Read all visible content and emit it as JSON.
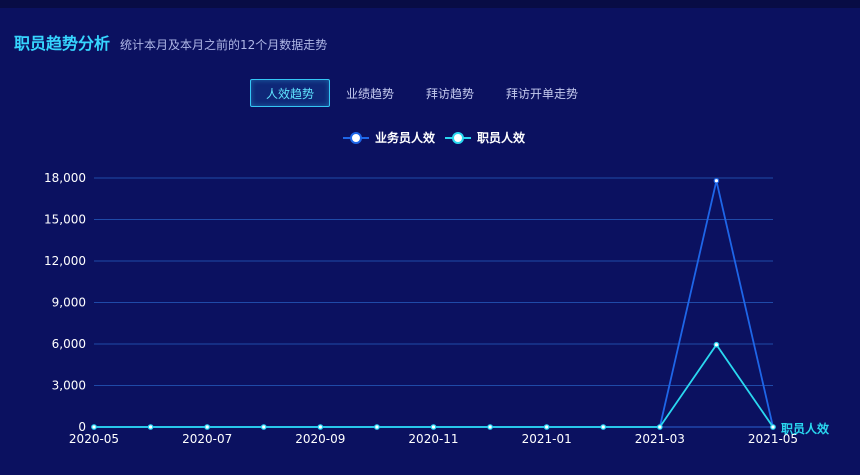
{
  "header": {
    "title": "职员趋势分析",
    "subtitle": "统计本月及本月之前的12个月数据走势"
  },
  "tabs": [
    {
      "label": "人效趋势",
      "active": true
    },
    {
      "label": "业绩趋势",
      "active": false
    },
    {
      "label": "拜访趋势",
      "active": false
    },
    {
      "label": "拜访开单走势",
      "active": false
    }
  ],
  "colors": {
    "background": "#0b1160",
    "title": "#36d6ff",
    "series_1": "#1e66e8",
    "series_2": "#2ad8f0",
    "grid": "#1f4aa8"
  },
  "chart_data": {
    "type": "line",
    "x": [
      "2020-05",
      "2020-06",
      "2020-07",
      "2020-08",
      "2020-09",
      "2020-10",
      "2020-11",
      "2020-12",
      "2021-01",
      "2021-02",
      "2021-03",
      "2021-04",
      "2021-05"
    ],
    "x_tick_labels": [
      "2020-05",
      "2020-07",
      "2020-09",
      "2020-11",
      "2021-01",
      "2021-03",
      "2021-05"
    ],
    "y_tick_labels": [
      "0",
      "3,000",
      "6,000",
      "9,000",
      "12,000",
      "15,000",
      "18,000"
    ],
    "ylim": [
      0,
      18000
    ],
    "grid": true,
    "legend_position": "top-center",
    "series": [
      {
        "name": "业务员人效",
        "values": [
          0,
          0,
          0,
          0,
          0,
          0,
          0,
          0,
          0,
          0,
          0,
          17800,
          0
        ]
      },
      {
        "name": "职员人效",
        "values": [
          0,
          0,
          0,
          0,
          0,
          0,
          0,
          0,
          0,
          0,
          0,
          5950,
          0
        ]
      }
    ],
    "end_label": "职员人效"
  }
}
